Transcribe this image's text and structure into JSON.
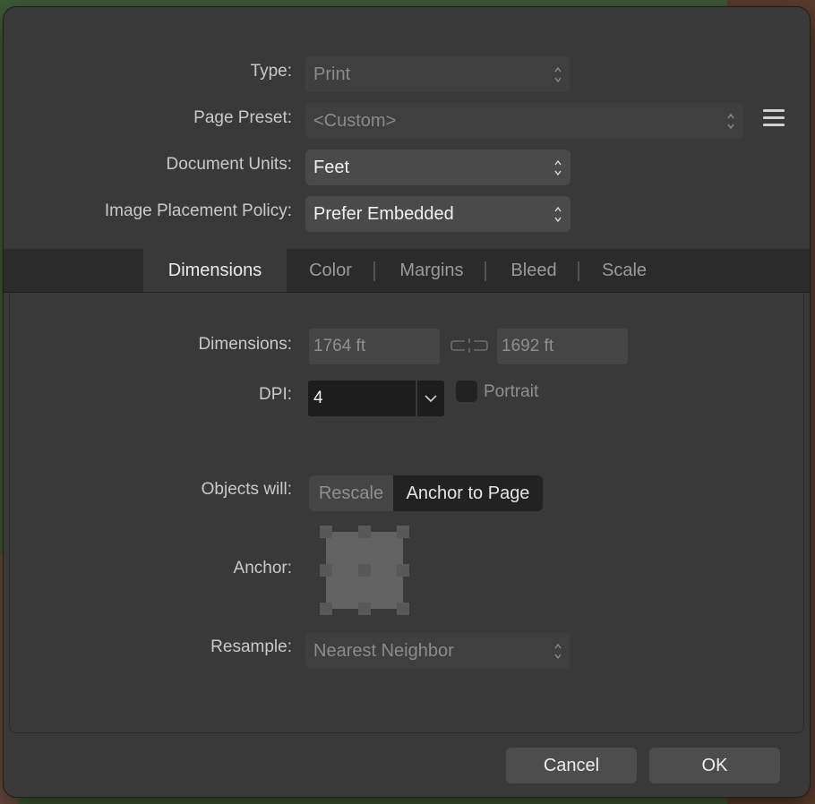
{
  "dialog": {
    "type": {
      "label": "Type:",
      "value": "Print"
    },
    "page_preset": {
      "label": "Page Preset:",
      "value": "<Custom>"
    },
    "document_units": {
      "label": "Document Units:",
      "value": "Feet"
    },
    "image_placement": {
      "label": "Image Placement Policy:",
      "value": "Prefer Embedded"
    },
    "tabs": [
      {
        "label": "Dimensions",
        "active": true
      },
      {
        "label": "Color",
        "active": false
      },
      {
        "label": "Margins",
        "active": false
      },
      {
        "label": "Bleed",
        "active": false
      },
      {
        "label": "Scale",
        "active": false
      }
    ],
    "dimensions": {
      "label": "Dimensions:",
      "width": "1764 ft",
      "height": "1692 ft"
    },
    "dpi": {
      "label": "DPI:",
      "value": "4"
    },
    "portrait": {
      "label": "Portrait",
      "checked": false
    },
    "objects_will": {
      "label": "Objects will:",
      "options": [
        "Rescale",
        "Anchor to Page"
      ],
      "selected": "Anchor to Page"
    },
    "anchor": {
      "label": "Anchor:"
    },
    "resample": {
      "label": "Resample:",
      "value": "Nearest Neighbor"
    },
    "buttons": {
      "cancel": "Cancel",
      "ok": "OK"
    }
  },
  "colors": {
    "dialog_bg": "#393939",
    "tabbar_bg": "#2b2b2b",
    "field_bg": "#454545",
    "dark_field_bg": "#1d1d1d",
    "button_bg": "#4d4d4d"
  }
}
